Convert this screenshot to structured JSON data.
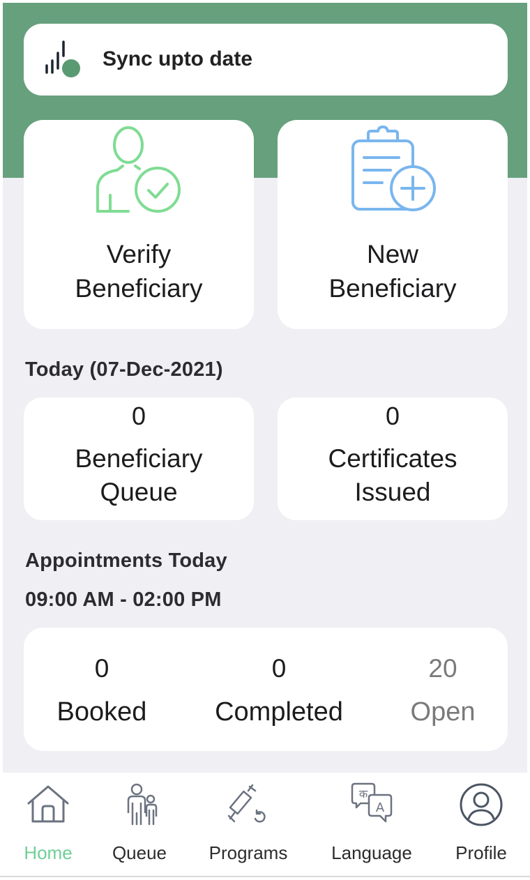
{
  "sync": {
    "status": "Sync upto date",
    "icon": "signal-sync-icon"
  },
  "actions": [
    {
      "label_line1": "Verify",
      "label_line2": "Beneficiary",
      "icon": "verify-user-icon",
      "color": "#7fdc93"
    },
    {
      "label_line1": "New",
      "label_line2": "Beneficiary",
      "icon": "clipboard-add-icon",
      "color": "#79b6ee"
    }
  ],
  "today": {
    "heading": "Today (07-Dec-2021)",
    "stats": [
      {
        "value": "0",
        "label_line1": "Beneficiary",
        "label_line2": "Queue"
      },
      {
        "value": "0",
        "label_line1": "Certificates",
        "label_line2": "Issued"
      }
    ]
  },
  "appointments": {
    "heading": "Appointments Today",
    "time_range": "09:00 AM - 02:00 PM",
    "columns": [
      {
        "value": "0",
        "label": "Booked"
      },
      {
        "value": "0",
        "label": "Completed"
      },
      {
        "value": "20",
        "label": "Open"
      }
    ]
  },
  "tabs": [
    {
      "label": "Home",
      "icon": "home-icon",
      "active": true
    },
    {
      "label": "Queue",
      "icon": "people-icon",
      "active": false
    },
    {
      "label": "Programs",
      "icon": "syringe-icon",
      "active": false
    },
    {
      "label": "Language",
      "icon": "translate-icon",
      "active": false
    },
    {
      "label": "Profile",
      "icon": "profile-icon",
      "active": false
    }
  ],
  "colors": {
    "header_green": "#66a07d",
    "active_tab": "#6fcf97",
    "background": "#efeff4"
  }
}
